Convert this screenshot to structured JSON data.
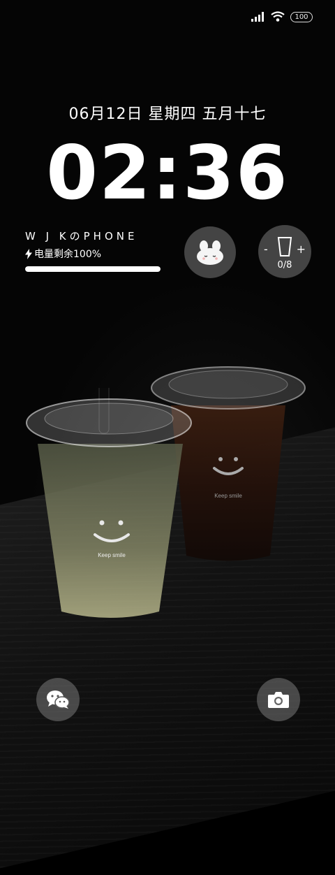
{
  "status_bar": {
    "battery_level": "100",
    "icons": [
      "signal-icon",
      "wifi-icon",
      "battery-icon"
    ]
  },
  "lockscreen": {
    "date": "06月12日 星期四 五月十七",
    "time": "02:36",
    "owner_name": "W J KのPHONE",
    "battery_text": "电量剩余100%",
    "battery_fraction": 1.0
  },
  "widgets": {
    "water": {
      "minus": "-",
      "plus": "+",
      "count": "0/8"
    }
  },
  "wallpaper": {
    "cup_text": "Keep smile"
  },
  "shortcuts": {
    "left": "wechat-icon",
    "right": "camera-icon"
  }
}
